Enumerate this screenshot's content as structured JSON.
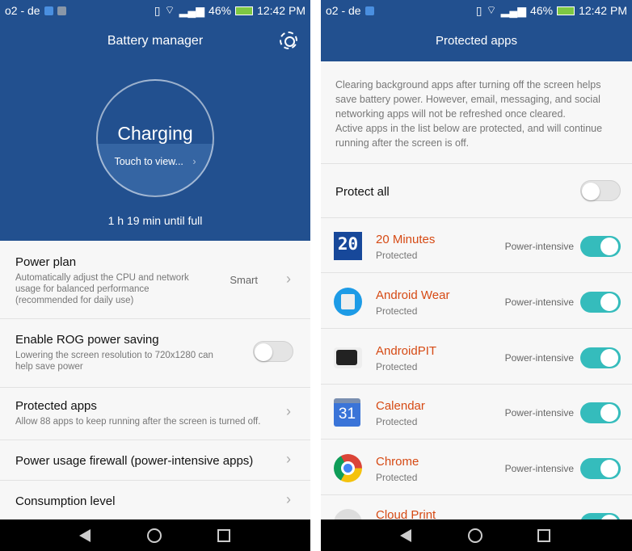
{
  "status_bar": {
    "carrier": "o2 - de",
    "battery": "46%",
    "time": "12:42 PM"
  },
  "battery_manager": {
    "title": "Battery manager",
    "status": "Charging",
    "touch_label": "Touch to view...",
    "time_until_full": "1 h 19 min until full",
    "items": [
      {
        "title": "Power plan",
        "subtitle": "Automatically adjust the CPU and network usage for balanced performance (recommended for daily use)",
        "value": "Smart"
      },
      {
        "title": "Enable ROG power saving",
        "subtitle": "Lowering the screen resolution to 720x1280 can help save power",
        "toggle": false
      },
      {
        "title": "Protected apps",
        "subtitle": "Allow 88 apps to keep running after the screen is turned off."
      },
      {
        "title": "Power usage firewall (power-intensive apps)"
      },
      {
        "title": "Consumption level"
      }
    ]
  },
  "protected_apps": {
    "title": "Protected apps",
    "description": "Clearing background apps after turning off the screen helps save battery power. However, email, messaging, and social networking apps will not be refreshed once cleared.\nActive apps in the list below are protected, and will continue running after the screen is off.",
    "protect_all_label": "Protect all",
    "protect_all": false,
    "apps": [
      {
        "name": "20 Minutes",
        "status": "Protected",
        "tag": "Power-intensive",
        "on": true,
        "icon": "20-minutes-icon"
      },
      {
        "name": "Android Wear",
        "status": "Protected",
        "tag": "Power-intensive",
        "on": true,
        "icon": "android-wear-icon"
      },
      {
        "name": "AndroidPIT",
        "status": "Protected",
        "tag": "Power-intensive",
        "on": true,
        "icon": "androidpit-icon"
      },
      {
        "name": "Calendar",
        "status": "Protected",
        "tag": "Power-intensive",
        "on": true,
        "icon": "calendar-icon",
        "icon_text": "31"
      },
      {
        "name": "Chrome",
        "status": "Protected",
        "tag": "Power-intensive",
        "on": true,
        "icon": "chrome-icon"
      },
      {
        "name": "Cloud Print",
        "on": true,
        "icon": "cloud-print-icon"
      }
    ]
  },
  "colors": {
    "header": "#22508f",
    "toggle_on": "#35bcbc",
    "app_name": "#d64a14"
  }
}
